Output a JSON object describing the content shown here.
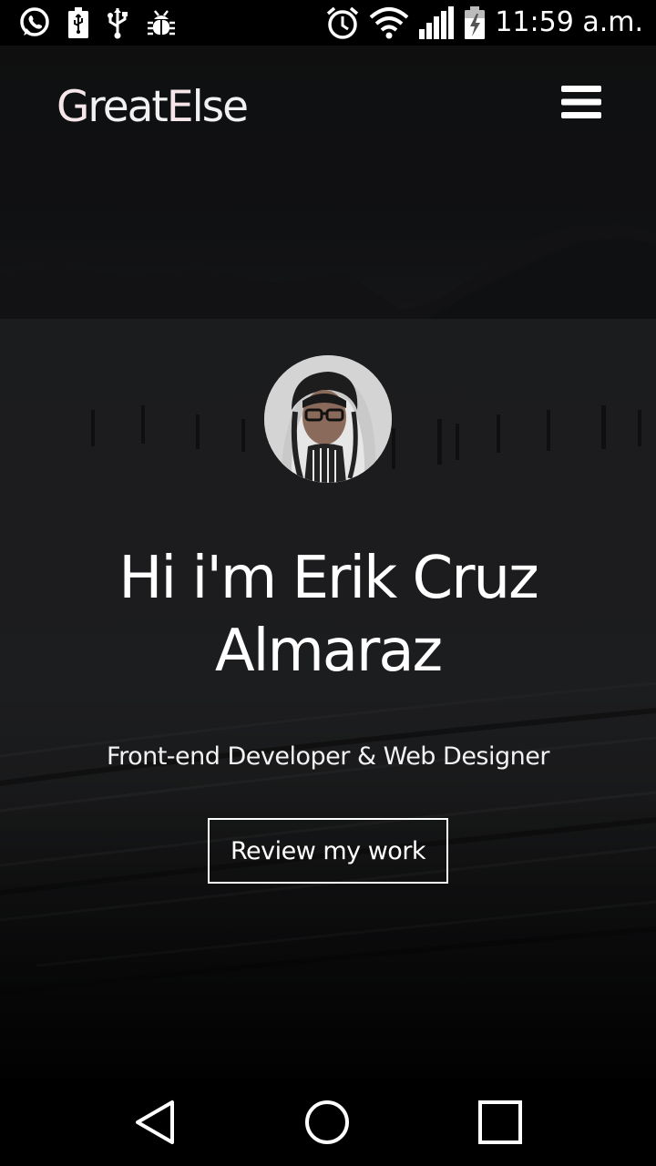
{
  "status_bar": {
    "time": "11:59 a.m.",
    "left_icons": [
      "whatsapp-icon",
      "battery-usb-icon",
      "usb-icon",
      "debug-bug-icon"
    ],
    "right_icons": [
      "alarm-clock-icon",
      "wifi-icon",
      "cellular-signal-icon",
      "battery-charging-icon"
    ]
  },
  "header": {
    "logo_parts": [
      "G",
      "reat",
      "E",
      "lse"
    ],
    "logo_accent_color": "#f6e6ea",
    "menu_icon": "hamburger-menu-icon"
  },
  "hero": {
    "title": "Hi i'm Erik Cruz Almaraz",
    "subtitle": "Front-end Developer & Web Designer",
    "cta_label": "Review my work"
  },
  "nav_bar": {
    "buttons": [
      "back-triangle-icon",
      "home-circle-icon",
      "recents-square-icon"
    ]
  },
  "colors": {
    "text": "#ffffff",
    "background_dark": "#17181a",
    "bar": "#000000"
  }
}
